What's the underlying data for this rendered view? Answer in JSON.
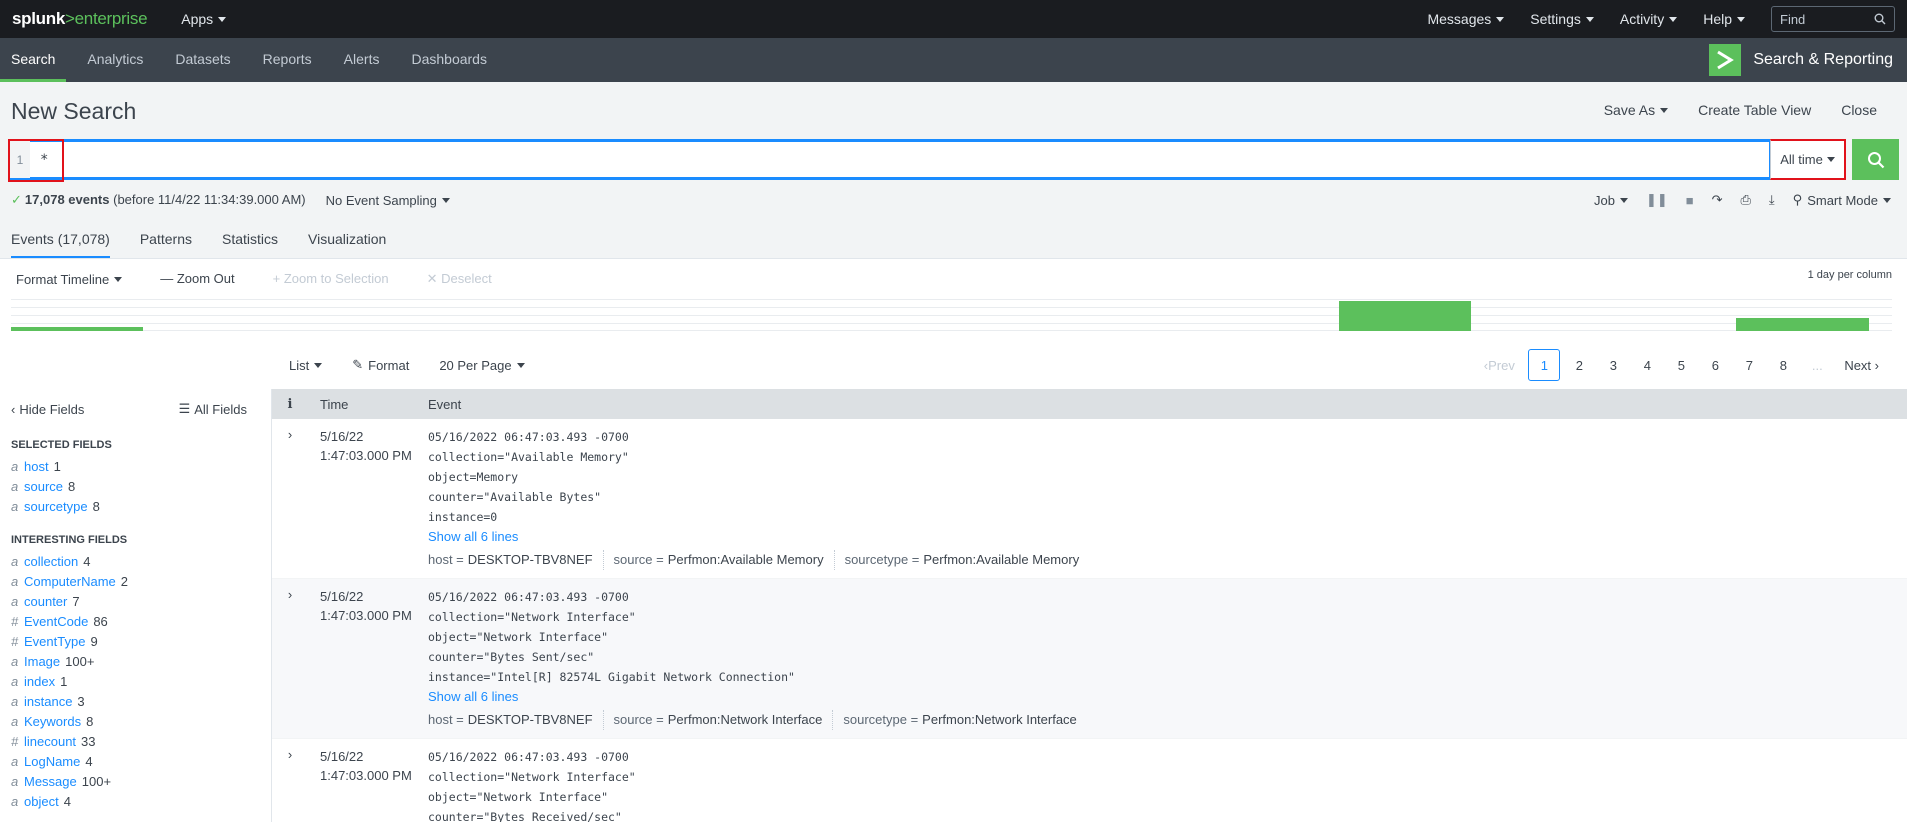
{
  "topbar": {
    "logo_splunk": "splunk",
    "logo_gt": ">",
    "logo_enterprise": "enterprise",
    "apps": "Apps",
    "messages": "Messages",
    "settings": "Settings",
    "activity": "Activity",
    "help": "Help",
    "find_placeholder": "Find"
  },
  "appbar": {
    "tabs": [
      "Search",
      "Analytics",
      "Datasets",
      "Reports",
      "Alerts",
      "Dashboards"
    ],
    "app_title": "Search & Reporting"
  },
  "page": {
    "title": "New Search",
    "save_as": "Save As",
    "create_table_view": "Create Table View",
    "close": "Close"
  },
  "search": {
    "line_number": "1",
    "query": "*",
    "time_range": "All time"
  },
  "status": {
    "event_count": "17,078 events",
    "before": "(before 11/4/22 11:34:39.000 AM)",
    "sampling": "No Event Sampling",
    "job": "Job",
    "mode": "Smart Mode"
  },
  "result_tabs": [
    "Events (17,078)",
    "Patterns",
    "Statistics",
    "Visualization"
  ],
  "timeline": {
    "format": "Format Timeline",
    "zoom_out": "Zoom Out",
    "zoom_selection": "Zoom to Selection",
    "deselect": "Deselect",
    "scale": "1 day per column",
    "bars": [
      {
        "start": 0.0,
        "end": 0.07,
        "level": 0.12
      },
      {
        "start": 0.706,
        "end": 0.776,
        "level": 0.95
      },
      {
        "start": 0.917,
        "end": 0.988,
        "level": 0.42
      }
    ]
  },
  "results_toolbar": {
    "list": "List",
    "format": "Format",
    "per_page": "20 Per Page",
    "prev": "Prev",
    "pages": [
      "1",
      "2",
      "3",
      "4",
      "5",
      "6",
      "7",
      "8"
    ],
    "ellipsis": "...",
    "next": "Next"
  },
  "sidebar": {
    "hide_fields": "Hide Fields",
    "all_fields": "All Fields",
    "selected_heading": "SELECTED FIELDS",
    "selected": [
      {
        "type": "a",
        "name": "host",
        "count": "1"
      },
      {
        "type": "a",
        "name": "source",
        "count": "8"
      },
      {
        "type": "a",
        "name": "sourcetype",
        "count": "8"
      }
    ],
    "interesting_heading": "INTERESTING FIELDS",
    "interesting": [
      {
        "type": "a",
        "name": "collection",
        "count": "4"
      },
      {
        "type": "a",
        "name": "ComputerName",
        "count": "2"
      },
      {
        "type": "a",
        "name": "counter",
        "count": "7"
      },
      {
        "type": "#",
        "name": "EventCode",
        "count": "86"
      },
      {
        "type": "#",
        "name": "EventType",
        "count": "9"
      },
      {
        "type": "a",
        "name": "Image",
        "count": "100+"
      },
      {
        "type": "a",
        "name": "index",
        "count": "1"
      },
      {
        "type": "a",
        "name": "instance",
        "count": "3"
      },
      {
        "type": "a",
        "name": "Keywords",
        "count": "8"
      },
      {
        "type": "#",
        "name": "linecount",
        "count": "33"
      },
      {
        "type": "a",
        "name": "LogName",
        "count": "4"
      },
      {
        "type": "a",
        "name": "Message",
        "count": "100+"
      },
      {
        "type": "a",
        "name": "object",
        "count": "4"
      }
    ]
  },
  "events_table": {
    "col_info": "i",
    "col_time": "Time",
    "col_event": "Event",
    "rows": [
      {
        "date": "5/16/22",
        "time": "1:47:03.000 PM",
        "lines": [
          "05/16/2022 06:47:03.493 -0700",
          "collection=\"Available Memory\"",
          "object=Memory",
          "counter=\"Available Bytes\"",
          "instance=0"
        ],
        "show_all": "Show all 6 lines",
        "host": "DESKTOP-TBV8NEF",
        "source": "Perfmon:Available Memory",
        "sourcetype": "Perfmon:Available Memory"
      },
      {
        "date": "5/16/22",
        "time": "1:47:03.000 PM",
        "lines": [
          "05/16/2022 06:47:03.493 -0700",
          "collection=\"Network Interface\"",
          "object=\"Network Interface\"",
          "counter=\"Bytes Sent/sec\"",
          "instance=\"Intel[R] 82574L Gigabit Network Connection\""
        ],
        "show_all": "Show all 6 lines",
        "host": "DESKTOP-TBV8NEF",
        "source": "Perfmon:Network Interface",
        "sourcetype": "Perfmon:Network Interface"
      },
      {
        "date": "5/16/22",
        "time": "1:47:03.000 PM",
        "lines": [
          "05/16/2022 06:47:03.493 -0700",
          "collection=\"Network Interface\"",
          "object=\"Network Interface\"",
          "counter=\"Bytes Received/sec\""
        ],
        "show_all": "",
        "host": "",
        "source": "",
        "sourcetype": ""
      }
    ]
  },
  "meta_labels": {
    "host": "host =",
    "source": "source =",
    "sourcetype": "sourcetype ="
  },
  "colors": {
    "accent_green": "#5cc05c",
    "accent_blue": "#1a8cff",
    "highlight_red": "#e1121b",
    "topbar_bg": "#1a1c20",
    "appbar_bg": "#3c444d"
  }
}
